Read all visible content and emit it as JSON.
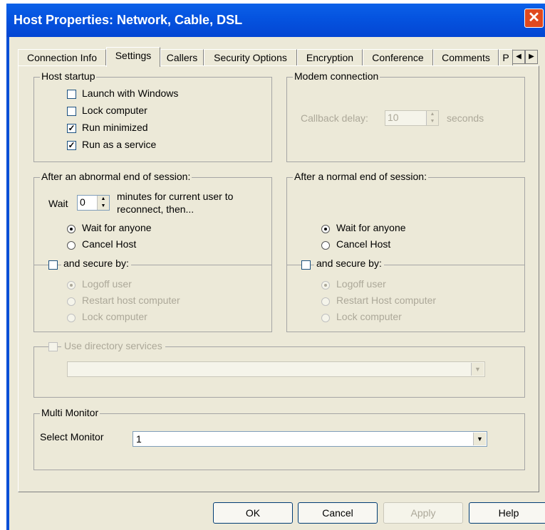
{
  "window": {
    "title": "Host Properties: Network, Cable, DSL"
  },
  "tabs": [
    "Connection Info",
    "Settings",
    "Callers",
    "Security Options",
    "Encryption",
    "Conference",
    "Comments",
    "P"
  ],
  "host_startup": {
    "title": "Host startup",
    "items": [
      {
        "label": "Launch with Windows",
        "checked": false
      },
      {
        "label": "Lock computer",
        "checked": false
      },
      {
        "label": "Run minimized",
        "checked": true
      },
      {
        "label": "Run as a service",
        "checked": true
      }
    ]
  },
  "modem": {
    "title": "Modem connection",
    "callback_label": "Callback delay:",
    "callback_value": "10",
    "seconds_label": "seconds"
  },
  "abnormal": {
    "title": "After an abnormal end of session:",
    "wait_label": "Wait",
    "wait_value": "0",
    "minutes_line1": "minutes for current user to",
    "minutes_line2": "reconnect, then...",
    "radio1": "Wait for anyone",
    "radio2": "Cancel Host",
    "secure_label": "and secure by:",
    "sec1": "Logoff user",
    "sec2": "Restart host computer",
    "sec3": "Lock computer"
  },
  "normal": {
    "title": "After a normal end of session:",
    "radio1": "Wait for anyone",
    "radio2": "Cancel Host",
    "secure_label": "and secure by:",
    "sec1": "Logoff user",
    "sec2": "Restart Host computer",
    "sec3": "Lock computer"
  },
  "directory": {
    "label": "Use directory services",
    "value": ""
  },
  "multi_monitor": {
    "title": "Multi Monitor",
    "select_label": "Select Monitor",
    "value": "1"
  },
  "buttons": {
    "ok": "OK",
    "cancel": "Cancel",
    "apply": "Apply",
    "help": "Help"
  }
}
